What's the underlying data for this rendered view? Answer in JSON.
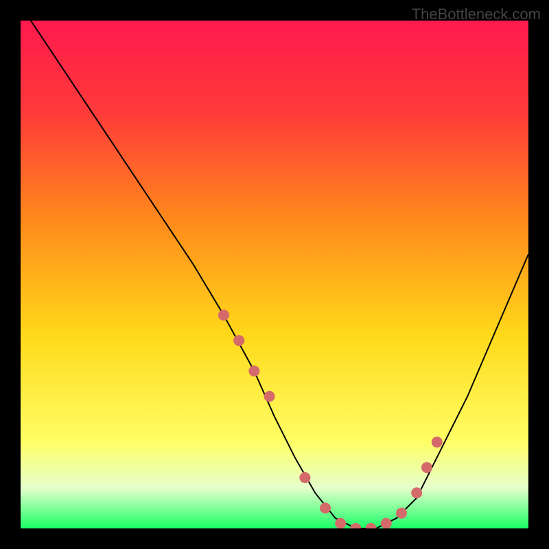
{
  "watermark": "TheBottleneck.com",
  "chart_data": {
    "type": "line",
    "title": "",
    "xlabel": "",
    "ylabel": "",
    "xlim": [
      0,
      100
    ],
    "ylim": [
      0,
      100
    ],
    "gradient_stops": [
      {
        "offset": 0,
        "color": "#ff1a4d"
      },
      {
        "offset": 18,
        "color": "#ff3a3a"
      },
      {
        "offset": 40,
        "color": "#ff8c1a"
      },
      {
        "offset": 62,
        "color": "#ffd91a"
      },
      {
        "offset": 83,
        "color": "#ffff66"
      },
      {
        "offset": 92,
        "color": "#e6ffcc"
      },
      {
        "offset": 100,
        "color": "#1aff66"
      }
    ],
    "series": [
      {
        "name": "curve",
        "x": [
          2,
          10,
          18,
          26,
          34,
          40,
          46,
          50,
          54,
          58,
          62,
          66,
          70,
          74,
          78,
          82,
          88,
          94,
          100
        ],
        "values": [
          100,
          88,
          76,
          64,
          52,
          42,
          31,
          22,
          14,
          7,
          2,
          0,
          0,
          2,
          6,
          14,
          26,
          40,
          54
        ]
      }
    ],
    "markers": {
      "name": "dots",
      "color": "#d46a6a",
      "radius": 8,
      "x": [
        40,
        43,
        46,
        49,
        56,
        60,
        63,
        66,
        69,
        72,
        75,
        78,
        80,
        82
      ],
      "values": [
        42,
        37,
        31,
        26,
        10,
        4,
        1,
        0,
        0,
        1,
        3,
        7,
        12,
        17
      ]
    }
  }
}
